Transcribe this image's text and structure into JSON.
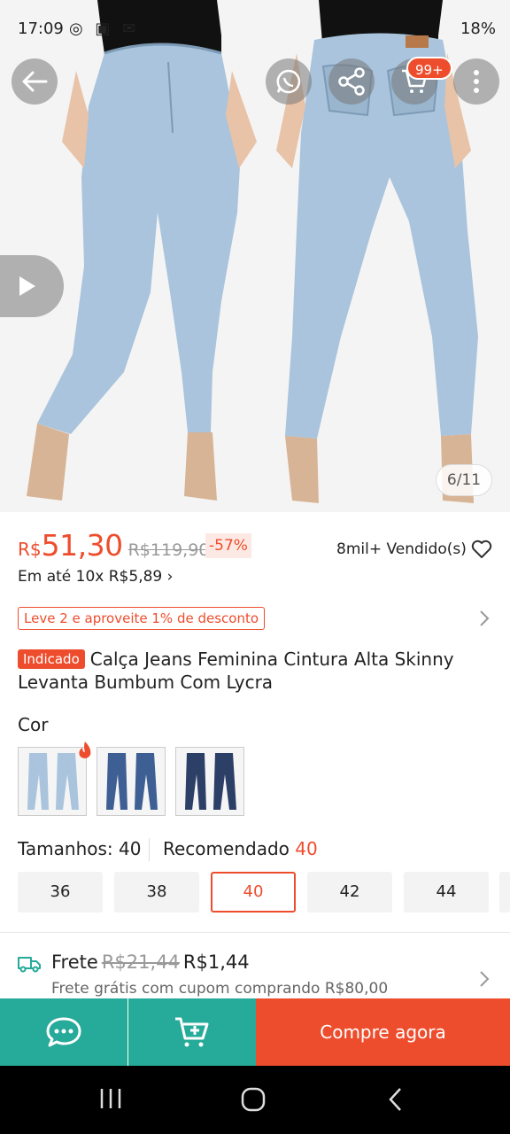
{
  "status_bar": {
    "time": "17:09",
    "battery": "18%"
  },
  "gallery": {
    "counter": "6/11",
    "cart_badge": "99+"
  },
  "price": {
    "currency": "R$",
    "current": "51,30",
    "original": "R$119,90",
    "discount": "-57%",
    "sold": "8mil+ Vendido(s)",
    "installments": "Em até 10x R$5,89 ›"
  },
  "promo": {
    "text": "Leve 2 e aproveite 1% de desconto"
  },
  "product": {
    "badge": "Indicado",
    "title": "Calça Jeans Feminina Cintura Alta Skinny Levanta Bumbum Com Lycra"
  },
  "variants": {
    "label": "Cor",
    "colors": [
      "#a9c4dc",
      "#3e5f93",
      "#2c3f66"
    ]
  },
  "sizes": {
    "label": "Tamanhos: 40",
    "recommended_label": "Recomendado",
    "recommended_value": "40",
    "options": [
      "36",
      "38",
      "40",
      "42",
      "44"
    ],
    "selected": "40"
  },
  "shipping": {
    "label": "Frete",
    "old_price": "R$21,44",
    "price": "R$1,44",
    "note": "Frete grátis com cupom comprando R$80,00"
  },
  "actions": {
    "buy_now": "Compre agora"
  },
  "colors": {
    "accent": "#ee4d2d",
    "teal": "#26aa99",
    "denim": "#a9c4dc"
  }
}
